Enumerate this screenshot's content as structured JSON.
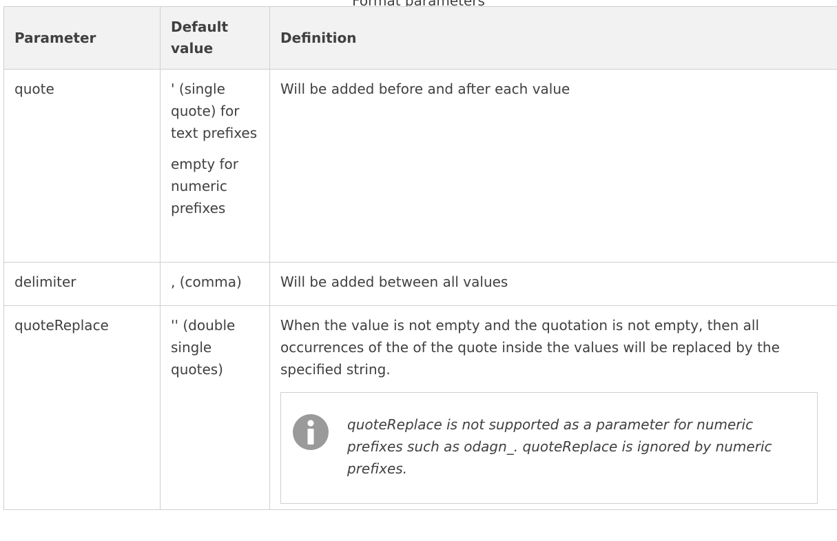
{
  "caption": "Format parameters",
  "table": {
    "headers": {
      "parameter": "Parameter",
      "default_value": "Default value",
      "definition": "Definition"
    },
    "rows": [
      {
        "parameter": "quote",
        "default_value_1": "' (single quote) for text prefixes",
        "default_value_2": "empty for numeric prefixes",
        "definition": "Will be added before and after each value"
      },
      {
        "parameter": "delimiter",
        "default_value": ", (comma)",
        "definition": "Will be added between all values"
      },
      {
        "parameter": "quoteReplace",
        "default_value": "'' (double single quotes)",
        "definition": "When the value is not empty and the quotation is not empty, then all occurrences of the of the quote inside the values will be replaced by the specified string.",
        "note": {
          "icon": "info-icon",
          "text": "quoteReplace is not supported as a parameter for numeric prefixes such as odagn_. quoteReplace is ignored by numeric prefixes."
        }
      }
    ]
  },
  "colors": {
    "text": "#404040",
    "header_bg": "#f2f2f2",
    "border": "#cfcfcf",
    "icon_gray": "#9a9a9a"
  }
}
